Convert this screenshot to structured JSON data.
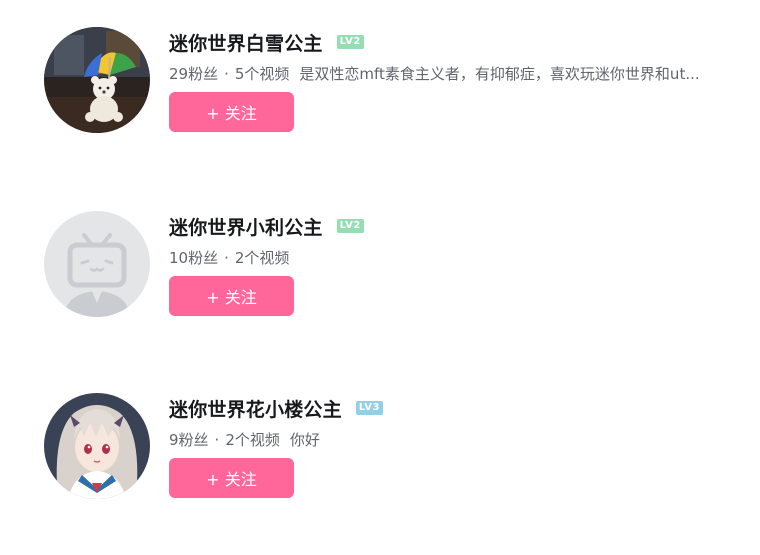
{
  "colors": {
    "follow_button_bg": "#ff6699",
    "level2_badge": "#95ddb2",
    "level3_badge": "#92d1e5",
    "name_text": "#18191c",
    "meta_text": "#61666d"
  },
  "users": [
    {
      "name": "迷你世界白雪公主",
      "level": "LV2",
      "level_color": "#95ddb2",
      "followers": "29粉丝",
      "separator": "·",
      "videos": "5个视频",
      "bio": "是双性恋mft素食主义者，有抑郁症，喜欢玩迷你世界和ut...",
      "avatar_icon": "teddy-bear-umbrella-avatar",
      "follow_label": "+ 关注"
    },
    {
      "name": "迷你世界小利公主",
      "level": "LV2",
      "level_color": "#95ddb2",
      "followers": "10粉丝",
      "separator": "·",
      "videos": "2个视频",
      "bio": "",
      "avatar_icon": "default-tv-avatar",
      "follow_label": "+ 关注"
    },
    {
      "name": "迷你世界花小楼公主",
      "level": "LV3",
      "level_color": "#92d1e5",
      "followers": "9粉丝",
      "separator": "·",
      "videos": "2个视频",
      "bio": "你好",
      "avatar_icon": "anime-girl-avatar",
      "follow_label": "+ 关注"
    }
  ]
}
